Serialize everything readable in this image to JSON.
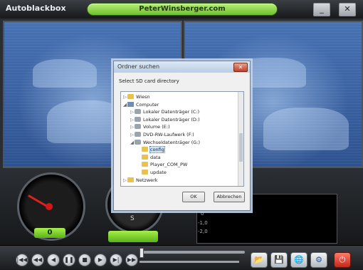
{
  "window": {
    "title": "Autoblackbox",
    "url": "PeterWinsberger.com",
    "minimize_label": "_",
    "close_label": "✕"
  },
  "dashboard": {
    "speed_value": "0",
    "compass_label": "S",
    "graph_ylabels": [
      "0",
      "-1,0",
      "-2,0"
    ]
  },
  "dialog": {
    "title": "Ordner suchen",
    "prompt": "Select SD card directory",
    "ok_label": "OK",
    "cancel_label": "Abbrechen",
    "tree": [
      {
        "label": "Wiesn",
        "icon": "folder-icon",
        "level": 0,
        "expander": "▷"
      },
      {
        "label": "Computer",
        "icon": "computer-icon",
        "level": 0,
        "expander": "◢"
      },
      {
        "label": "Lokaler Datenträger (C:)",
        "icon": "drive-icon",
        "level": 1,
        "expander": "▷"
      },
      {
        "label": "Lokaler Datenträger (D:)",
        "icon": "drive-icon",
        "level": 1,
        "expander": "▷"
      },
      {
        "label": "Volume (E:)",
        "icon": "drive-icon",
        "level": 1,
        "expander": "▷"
      },
      {
        "label": "DVD-RW-Laufwerk (F:)",
        "icon": "drive-icon",
        "level": 1,
        "expander": "▷"
      },
      {
        "label": "Wechseldatenträger (G:)",
        "icon": "drive-icon",
        "level": 1,
        "expander": "◢"
      },
      {
        "label": "config",
        "icon": "folder-icon",
        "level": 2,
        "expander": "",
        "selected": true
      },
      {
        "label": "data",
        "icon": "folder-icon",
        "level": 2,
        "expander": ""
      },
      {
        "label": "Player_COM_PW",
        "icon": "folder-icon",
        "level": 2,
        "expander": ""
      },
      {
        "label": "update",
        "icon": "folder-icon",
        "level": 2,
        "expander": ""
      },
      {
        "label": "Netzwerk",
        "icon": "folder-icon",
        "level": 0,
        "expander": "▷"
      }
    ]
  },
  "player": {
    "buttons": [
      {
        "name": "skip-start-button",
        "icon": "|◀◀"
      },
      {
        "name": "rewind-fast-button",
        "icon": "◀◀"
      },
      {
        "name": "step-back-button",
        "icon": "◀"
      },
      {
        "name": "pause-button",
        "icon": "❚❚"
      },
      {
        "name": "stop-button",
        "icon": "■"
      },
      {
        "name": "play-button",
        "icon": "▶"
      },
      {
        "name": "step-forward-button",
        "icon": "▶|"
      },
      {
        "name": "forward-fast-button",
        "icon": "▶▶"
      }
    ],
    "tools": [
      {
        "name": "open-folder-button",
        "icon": "📂"
      },
      {
        "name": "save-button",
        "icon": "💾"
      },
      {
        "name": "globe-button",
        "icon": "🌐"
      },
      {
        "name": "settings-button",
        "icon": "⚙"
      }
    ],
    "power_icon": "⏻"
  },
  "colors": {
    "accent_green": "#6cbf2c",
    "video_blue": "#3b64a5",
    "power_red": "#c1281a"
  }
}
